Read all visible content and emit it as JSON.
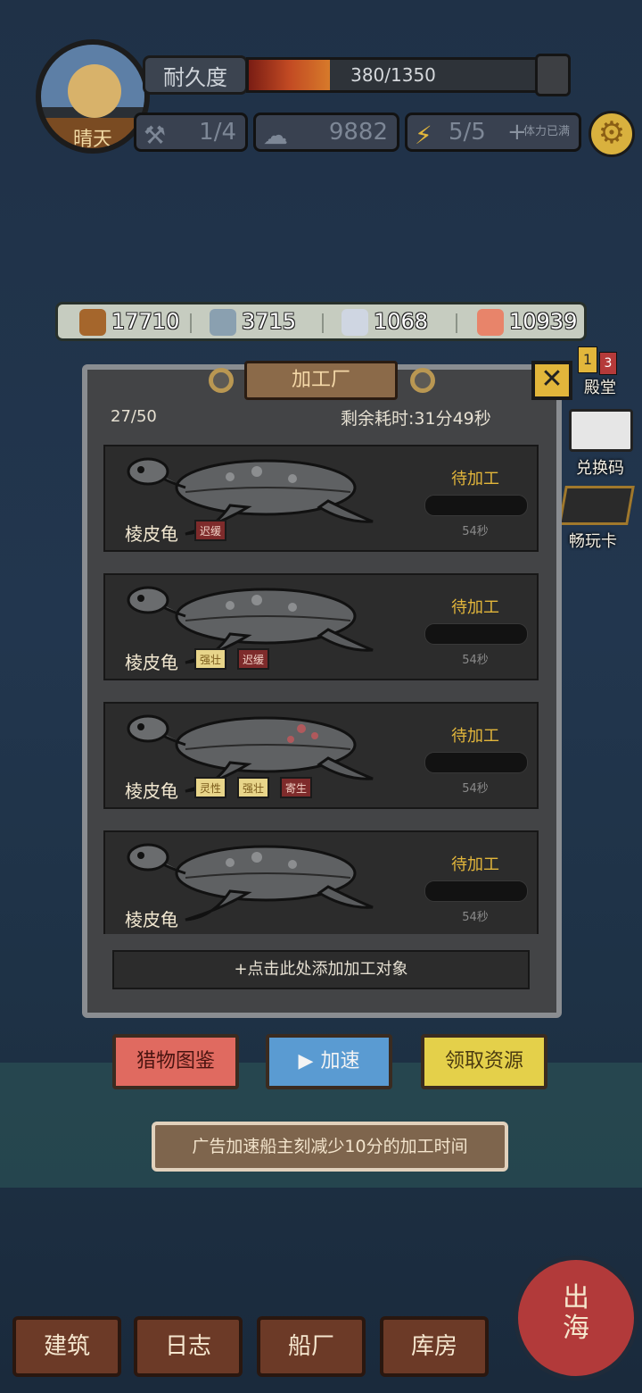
{
  "hud": {
    "weather": "晴天",
    "durability_label": "耐久度",
    "durability_text": "380/1350",
    "durability_fraction": 0.281,
    "tools": "1/4",
    "population": "9882",
    "energy": "5/5",
    "energy_note": "体力已满"
  },
  "resources": [
    {
      "name": "wood",
      "value": "17710",
      "color": "#a5662c"
    },
    {
      "name": "water",
      "value": "3715",
      "color": "#8aa0b0"
    },
    {
      "name": "iron",
      "value": "1068",
      "color": "#cfd6e2"
    },
    {
      "name": "fish",
      "value": "10939",
      "color": "#e8846a"
    }
  ],
  "side": {
    "ticket_count_a": "1",
    "ticket_count_b": "3",
    "ticket_label": "殿堂",
    "redeem_label": "兑换码",
    "pass_label": "畅玩卡"
  },
  "factory": {
    "title": "加工厂",
    "count": "27/50",
    "remaining": "剩余耗时:31分49秒",
    "items": [
      {
        "name": "棱皮龟",
        "status": "待加工",
        "time": "54秒",
        "tags": [
          {
            "text": "迟缓",
            "kind": "red"
          }
        ]
      },
      {
        "name": "棱皮龟",
        "status": "待加工",
        "time": "54秒",
        "tags": [
          {
            "text": "强壮",
            "kind": "gold"
          },
          {
            "text": "迟缓",
            "kind": "red"
          }
        ]
      },
      {
        "name": "棱皮龟",
        "status": "待加工",
        "time": "54秒",
        "tags": [
          {
            "text": "灵性",
            "kind": "gold"
          },
          {
            "text": "强壮",
            "kind": "gold"
          },
          {
            "text": "寄生",
            "kind": "red"
          }
        ]
      },
      {
        "name": "棱皮龟",
        "status": "待加工",
        "time": "54秒",
        "tags": []
      }
    ],
    "add_hint": "+点击此处添加加工对象"
  },
  "buttons": {
    "catalog": "猎物图鉴",
    "speedup": "加速",
    "claim": "领取资源"
  },
  "tip": "广告加速船主刻减少10分的加工时间",
  "nav": {
    "build": "建筑",
    "log": "日志",
    "shipyard": "船厂",
    "storage": "库房",
    "sail_line1": "出",
    "sail_line2": "海"
  },
  "colors": {
    "accent": "#e2b63b",
    "panel": "#434446"
  }
}
